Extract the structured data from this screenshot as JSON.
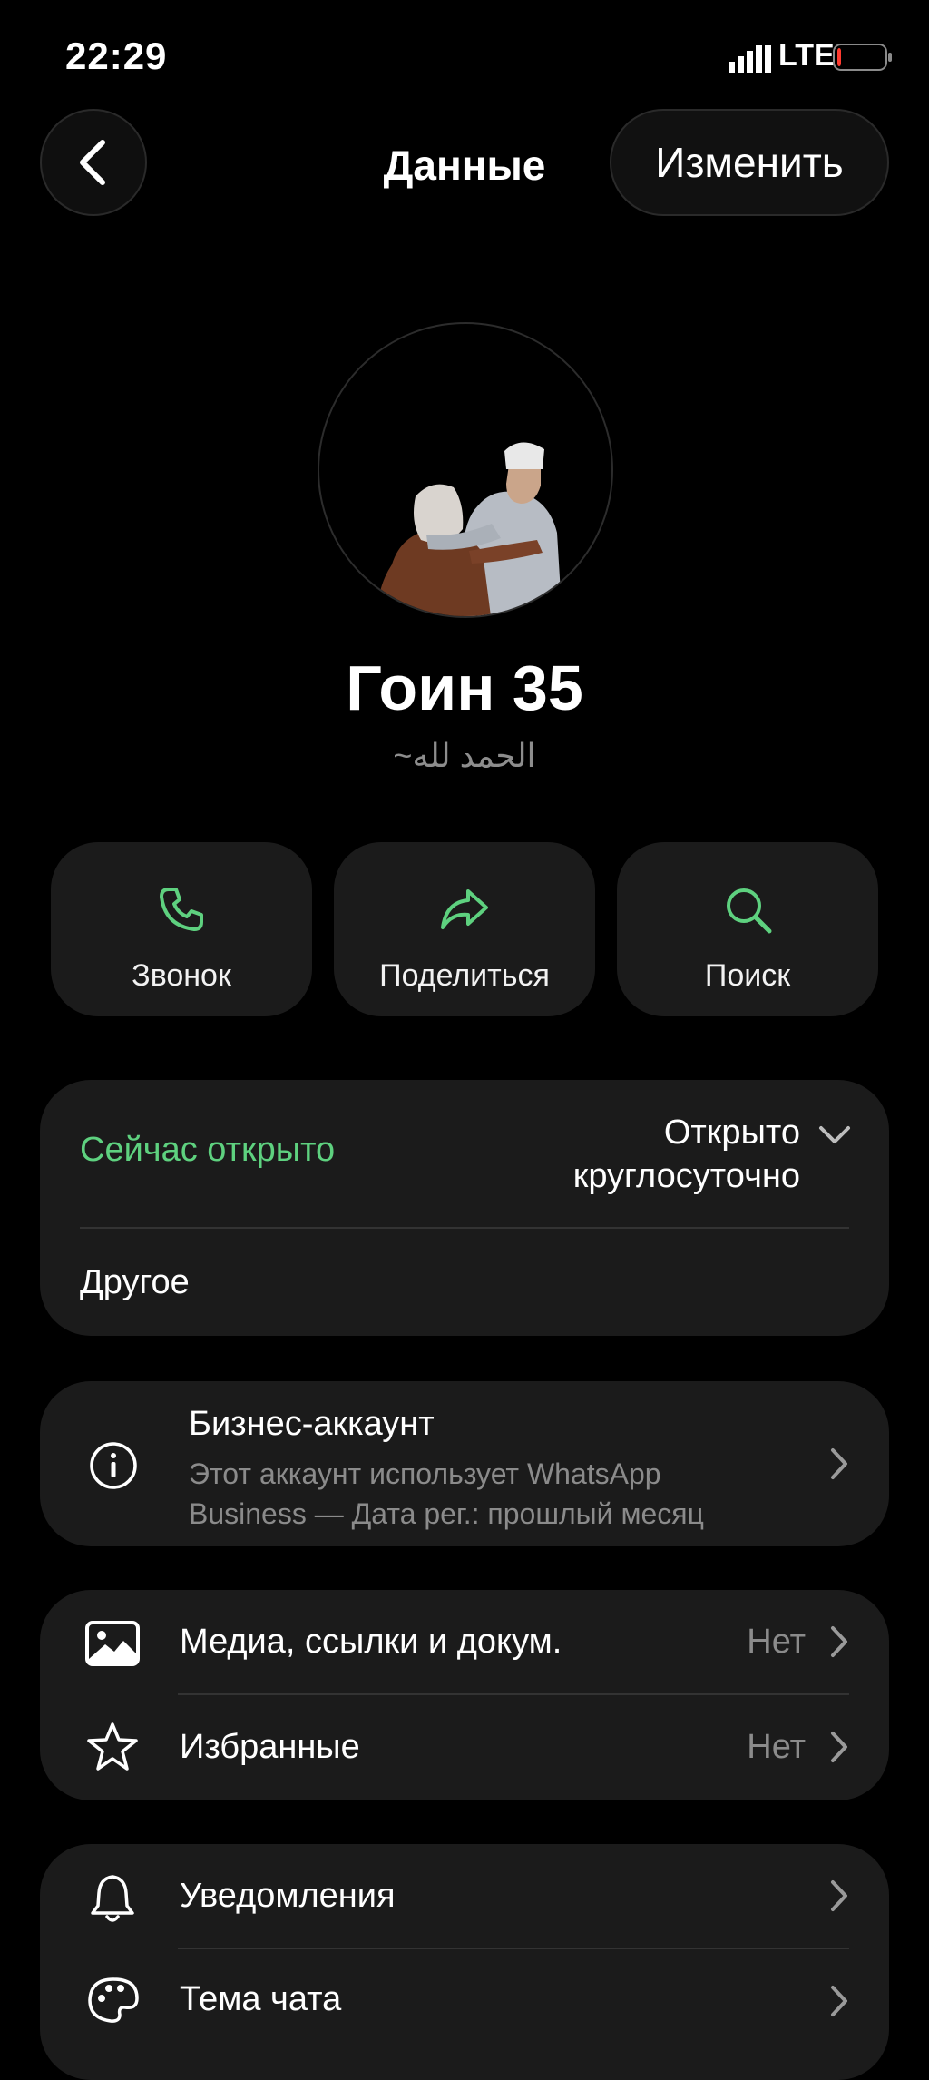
{
  "status_bar": {
    "time": "22:29",
    "network": "LTE",
    "battery_level": 0.08
  },
  "nav": {
    "title": "Данные",
    "edit_label": "Изменить"
  },
  "profile": {
    "name": "Гоин 35",
    "status": "~الحمد لله"
  },
  "actions": [
    {
      "label": "Звонок",
      "icon": "phone-icon"
    },
    {
      "label": "Поделиться",
      "icon": "share-icon"
    },
    {
      "label": "Поиск",
      "icon": "search-icon"
    }
  ],
  "hours": {
    "status": "Сейчас открыто",
    "value_line1": "Открыто",
    "value_line2": "круглосуточно",
    "other": "Другое"
  },
  "business": {
    "title": "Бизнес-аккаунт",
    "line1": "Этот аккаунт использует WhatsApp",
    "line2": "Business — Дата рег.: прошлый месяц"
  },
  "media_list": [
    {
      "label": "Медиа, ссылки и докум.",
      "value": "Нет",
      "icon": "image-icon"
    },
    {
      "label": "Избранные",
      "value": "Нет",
      "icon": "star-icon"
    }
  ],
  "settings_list": [
    {
      "label": "Уведомления",
      "icon": "bell-icon"
    },
    {
      "label": "Тема чата",
      "icon": "palette-icon"
    }
  ],
  "colors": {
    "accent_green": "#5ed17f",
    "card_bg": "#1b1b1b",
    "background": "#000000"
  }
}
